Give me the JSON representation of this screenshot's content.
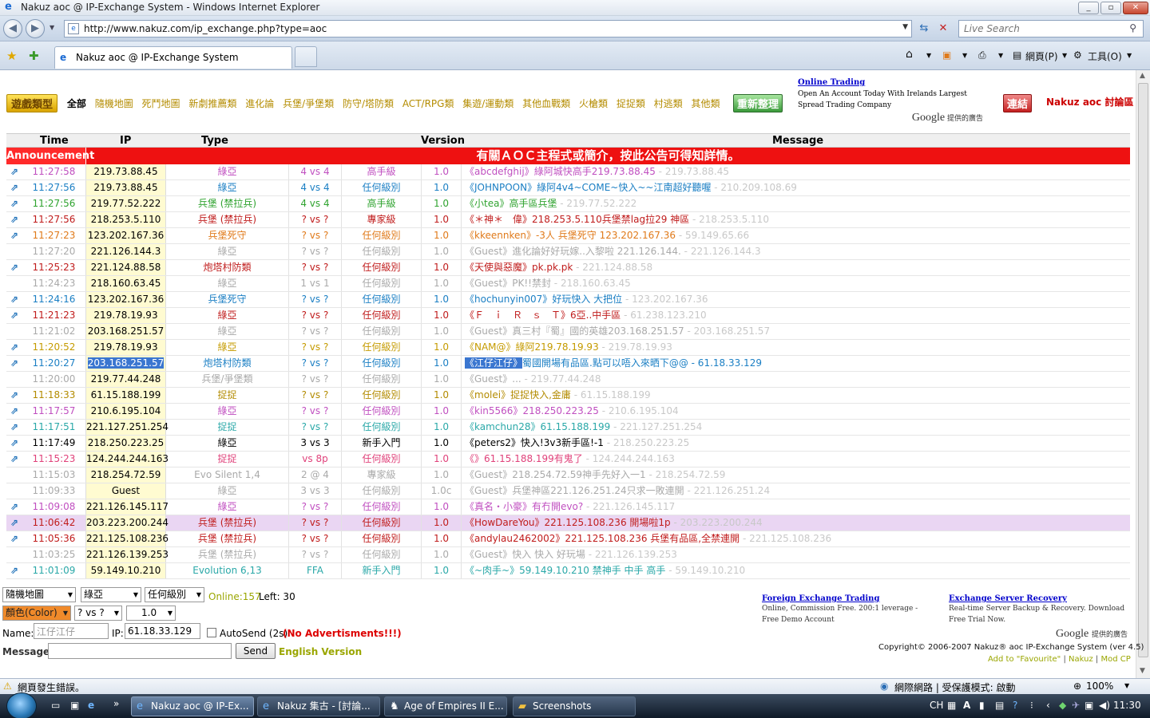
{
  "browser": {
    "title": "Nakuz aoc @ IP-Exchange System - Windows Internet Explorer",
    "url": "http://www.nakuz.com/ip_exchange.php?type=aoc",
    "search_placeholder": "Live Search",
    "tab_label": "Nakuz aoc @ IP-Exchange System",
    "cmd_page": "網頁(P)",
    "cmd_tools": "工具(O)"
  },
  "header": {
    "cat_badge": "遊戲類型",
    "categories": [
      "全部",
      "隨機地圖",
      "死鬥地圖",
      "新劇推薦類",
      "進化論",
      "兵堡/爭堡類",
      "防守/塔防類",
      "ACT/RPG類",
      "集遊/運動類",
      "其他血戰類",
      "火槍類",
      "捉捉類",
      "村逃類",
      "其他類"
    ],
    "refresh_badge": "重新整理",
    "ad_title": "Online Trading",
    "ad_body": "Open An Account Today With Irelands Largest Spread Trading Company",
    "google_ads": "Google",
    "google_ads_sub": "提供的廣告",
    "link_badge": "連結",
    "link_text": "Nakuz aoc 討論區"
  },
  "table": {
    "headers": {
      "time": "Time",
      "ip": "IP",
      "type": "Type",
      "version": "Version",
      "message": "Message"
    },
    "announcement_label": "Announcement",
    "announcement_text": "有關ＡＯＣ主程式或簡介，按此公告可得知詳情。",
    "rows": [
      {
        "icon": true,
        "time": "11:27:58",
        "ip": "219.73.88.45",
        "type": "綠亞",
        "vs": "4 vs 4",
        "level": "高手級",
        "ver": "1.0",
        "sender": "《abcdefghij》",
        "msg": "綠阿城快高手219.73.88.45",
        "mip": " - 219.73.88.45",
        "color": "#c04fc0",
        "sub": "#c04fc0"
      },
      {
        "icon": true,
        "time": "11:27:56",
        "ip": "219.73.88.45",
        "type": "綠亞",
        "vs": "4 vs 4",
        "level": "任何級別",
        "ver": "1.0",
        "sender": "《JOHNPOON》",
        "msg": "綠阿4v4~COME~快入~~江南超好聽喔",
        "mip": " - 210.209.108.69",
        "color": "#1b7fc4",
        "sub": "#1b7fc4"
      },
      {
        "icon": true,
        "time": "11:27:56",
        "ip": "219.77.52.222",
        "type": "兵堡 (禁拉兵)",
        "vs": "4 vs 4",
        "level": "高手級",
        "ver": "1.0",
        "sender": "《小tea》",
        "msg": "高手區兵堡",
        "mip": " - 219.77.52.222",
        "color": "#2fa32f",
        "sub": "#2fa32f"
      },
      {
        "icon": true,
        "time": "11:27:56",
        "ip": "218.253.5.110",
        "type": "兵堡 (禁拉兵)",
        "vs": "? vs ?",
        "level": "專家級",
        "ver": "1.0",
        "sender": "《＊神＊　偉》",
        "msg": "218.253.5.110兵堡禁lag拉29 神區",
        "mip": " - 218.253.5.110",
        "color": "#c01c1c",
        "sub": "#c01c1c"
      },
      {
        "icon": true,
        "time": "11:27:23",
        "ip": "123.202.167.36",
        "type": "兵堡死守",
        "vs": "? vs ?",
        "level": "任何級別",
        "ver": "1.0",
        "sender": "《kkeennken》",
        "msg": "-3人 兵堡死守 123.202.167.36",
        "mip": " - 59.149.65.66",
        "color": "#e07a1a",
        "sub": "#e07a1a"
      },
      {
        "icon": false,
        "time": "11:27:20",
        "ip": "221.126.144.3",
        "type": "綠亞",
        "vs": "? vs ?",
        "level": "任何級別",
        "ver": "1.0",
        "sender": "《Guest》",
        "msg": "進化論好好玩嫁..入黎啦 221.126.144.",
        "mip": " - 221.126.144.3",
        "color": "#aaaaaa",
        "sub": "#aaaaaa"
      },
      {
        "icon": true,
        "time": "11:25:23",
        "ip": "221.124.88.58",
        "type": "炮塔村防類",
        "vs": "? vs ?",
        "level": "任何級別",
        "ver": "1.0",
        "sender": "《天使與惡魔》",
        "msg": "pk.pk.pk",
        "mip": " - 221.124.88.58",
        "color": "#c01c1c",
        "sub": "#c01c1c"
      },
      {
        "icon": false,
        "time": "11:24:23",
        "ip": "218.160.63.45",
        "type": "綠亞",
        "vs": "1 vs 1",
        "level": "任何級別",
        "ver": "1.0",
        "sender": "《Guest》",
        "msg": "PK!!禁封",
        "mip": " - 218.160.63.45",
        "color": "#aaaaaa",
        "sub": "#aaaaaa"
      },
      {
        "icon": true,
        "time": "11:24:16",
        "ip": "123.202.167.36",
        "type": "兵堡死守",
        "vs": "? vs ?",
        "level": "任何級別",
        "ver": "1.0",
        "sender": "《hochunyin007》",
        "msg": "好玩快入 大把位",
        "mip": " - 123.202.167.36",
        "color": "#1b7fc4",
        "sub": "#1b7fc4"
      },
      {
        "icon": true,
        "time": "11:21:23",
        "ip": "219.78.19.93",
        "type": "綠亞",
        "vs": "? vs ?",
        "level": "任何級別",
        "ver": "1.0",
        "sender": "《Ｆ　ｉ　Ｒ　ｓ　Ｔ》",
        "msg": "6亞..中手區",
        "mip": " - 61.238.123.210",
        "color": "#c01c1c",
        "sub": "#c01c1c"
      },
      {
        "icon": false,
        "time": "11:21:02",
        "ip": "203.168.251.57",
        "type": "綠亞",
        "vs": "? vs ?",
        "level": "任何級別",
        "ver": "1.0",
        "sender": "《Guest》",
        "msg": "真三村『蜀』國的英雄203.168.251.57",
        "mip": " - 203.168.251.57",
        "color": "#aaaaaa",
        "sub": "#aaaaaa"
      },
      {
        "icon": true,
        "time": "11:20:52",
        "ip": "219.78.19.93",
        "type": "綠亞",
        "vs": "? vs ?",
        "level": "任何級別",
        "ver": "1.0",
        "sender": "《NAM@》",
        "msg": "綠阿219.78.19.93",
        "mip": " - 219.78.19.93",
        "color": "#c59b00",
        "sub": "#c59b00"
      },
      {
        "icon": true,
        "time": "11:20:27",
        "ip": "203.168.251.57",
        "type": "炮塔村防類",
        "vs": "? vs ?",
        "level": "任何級別",
        "ver": "1.0",
        "sender": "《江仔江仔》",
        "msg": "蜀國開場有品區.點可以唔入來晒下@@",
        "mip": " - 61.18.33.129",
        "color": "#1b7fc4",
        "sub": "#1b7fc4",
        "selected": true
      },
      {
        "icon": false,
        "time": "11:20:00",
        "ip": "219.77.44.248",
        "type": "兵堡/爭堡類",
        "vs": "? vs ?",
        "level": "任何級別",
        "ver": "1.0",
        "sender": "《Guest》",
        "msg": "...",
        "mip": " - 219.77.44.248",
        "color": "#aaaaaa",
        "sub": "#aaaaaa"
      },
      {
        "icon": true,
        "time": "11:18:33",
        "ip": "61.15.188.199",
        "type": "捉捉",
        "vs": "? vs ?",
        "level": "任何級別",
        "ver": "1.0",
        "sender": "《molei》",
        "msg": "捉捉快入,金庸",
        "mip": " - 61.15.188.199",
        "color": "#b38b00",
        "sub": "#b38b00"
      },
      {
        "icon": true,
        "time": "11:17:57",
        "ip": "210.6.195.104",
        "type": "綠亞",
        "vs": "? vs ?",
        "level": "任何級別",
        "ver": "1.0",
        "sender": "《kin5566》",
        "msg": "218.250.223.25",
        "mip": " - 210.6.195.104",
        "color": "#c04fc0",
        "sub": "#c04fc0"
      },
      {
        "icon": true,
        "time": "11:17:51",
        "ip": "221.127.251.254",
        "type": "捉捉",
        "vs": "? vs ?",
        "level": "任何級別",
        "ver": "1.0",
        "sender": "《kamchun28》",
        "msg": "61.15.188.199",
        "mip": " - 221.127.251.254",
        "color": "#2aa8a8",
        "sub": "#2aa8a8"
      },
      {
        "icon": true,
        "time": "11:17:49",
        "ip": "218.250.223.25",
        "type": "綠亞",
        "vs": "3 vs 3",
        "level": "新手入門",
        "ver": "1.0",
        "sender": "《peters2》",
        "msg": "快入!3v3新手區!-1",
        "mip": " - 218.250.223.25",
        "color": "#000000",
        "sub": "#000000"
      },
      {
        "icon": true,
        "time": "11:15:23",
        "ip": "124.244.244.163",
        "type": "捉捉",
        "vs": "vs 8p",
        "level": "任何級別",
        "ver": "1.0",
        "sender": "《》",
        "msg": "61.15.188.199有鬼了",
        "mip": " - 124.244.244.163",
        "color": "#e0417a",
        "sub": "#e0417a"
      },
      {
        "icon": false,
        "time": "11:15:03",
        "ip": "218.254.72.59",
        "type": "Evo Silent 1,4",
        "vs": "2 @ 4",
        "level": "專家級",
        "ver": "1.0",
        "sender": "《Guest》",
        "msg": "218.254.72.59神手先好入一1",
        "mip": " - 218.254.72.59",
        "color": "#aaaaaa",
        "sub": "#aaaaaa"
      },
      {
        "icon": false,
        "time": "11:09:33",
        "ip": "Guest",
        "type": "綠亞",
        "vs": "3 vs 3",
        "level": "任何級別",
        "ver": "1.0c",
        "sender": "《Guest》",
        "msg": "兵堡神區221.126.251.24只求一敗連開",
        "mip": " - 221.126.251.24",
        "color": "#aaaaaa",
        "sub": "#aaaaaa"
      },
      {
        "icon": true,
        "time": "11:09:08",
        "ip": "221.126.145.117",
        "type": "綠亞",
        "vs": "? vs ?",
        "level": "任何級別",
        "ver": "1.0",
        "sender": "《真名・小豪》",
        "msg": "有冇開evo?",
        "mip": " - 221.126.145.117",
        "color": "#c04fc0",
        "sub": "#c04fc0"
      },
      {
        "icon": true,
        "time": "11:06:42",
        "ip": "203.223.200.244",
        "type": "兵堡 (禁拉兵)",
        "vs": "? vs ?",
        "level": "任何級別",
        "ver": "1.0",
        "sender": "《HowDareYou》",
        "msg": "221.125.108.236 開場啦1p",
        "mip": " - 203.223.200.244",
        "color": "#c01c1c",
        "sub": "#c01c1c",
        "highlight": true
      },
      {
        "icon": true,
        "time": "11:05:36",
        "ip": "221.125.108.236",
        "type": "兵堡 (禁拉兵)",
        "vs": "? vs ?",
        "level": "任何級別",
        "ver": "1.0",
        "sender": "《andylau2462002》",
        "msg": "221.125.108.236 兵堡有品區,全禁連開",
        "mip": " - 221.125.108.236",
        "color": "#c01c1c",
        "sub": "#c01c1c"
      },
      {
        "icon": false,
        "time": "11:03:25",
        "ip": "221.126.139.253",
        "type": "兵堡 (禁拉兵)",
        "vs": "? vs ?",
        "level": "任何級別",
        "ver": "1.0",
        "sender": "《Guest》",
        "msg": "快入 快入 好玩場",
        "mip": " - 221.126.139.253",
        "color": "#aaaaaa",
        "sub": "#aaaaaa"
      },
      {
        "icon": true,
        "time": "11:01:09",
        "ip": "59.149.10.210",
        "type": "Evolution 6,13",
        "vs": "FFA",
        "level": "新手入門",
        "ver": "1.0",
        "sender": "《~肉手~》",
        "msg": "59.149.10.210 禁神手 中手 高手",
        "mip": " - 59.149.10.210",
        "color": "#2aa8a8",
        "sub": "#2aa8a8"
      }
    ]
  },
  "form": {
    "map_select": "隨機地圖",
    "type_select": "綠亞",
    "level_select": "任何級別",
    "online": "Online:157",
    "left": "Left: 30",
    "color_select": "顏色(Color)",
    "vs_select": "? vs ?",
    "ver_select": "1.0",
    "name_label": "Name:",
    "name_value": "江仔江仔",
    "ip_label": "IP:",
    "ip_value": "61.18.33.129",
    "autosend_label": "AutoSend (2s)",
    "no_ads": "(No Advertisments!!!)",
    "message_label": "Message:",
    "message_value": "",
    "send_label": "Send",
    "english_version": "English Version"
  },
  "footer_ads": {
    "ad1_title": "Foreign Exchange Trading",
    "ad1_body": "Online, Commission Free. 200:1 leverage - Free Demo Account",
    "ad2_title": "Exchange Server Recovery",
    "ad2_body": "Real-time Server Backup & Recovery. Download Free Trial Now.",
    "google_ads": "Google",
    "google_ads_sub": "提供的廣告",
    "copyright": "Copyright© 2006-2007  Nakuz® aoc IP-Exchange System (ver 4.5)",
    "favourite": "Add to \"Favourite\"",
    "nakuz_link": "Nakuz",
    "modcp_link": "Mod CP"
  },
  "statusbar": {
    "error_text": "網頁發生錯誤。",
    "zone_text": "網際網路 | 受保護模式: 啟動",
    "zoom": "100%"
  },
  "taskbar": {
    "items": [
      "Nakuz aoc @ IP-Ex...",
      "Nakuz 集古 - [討論...",
      "Age of Empires II E...",
      "Screenshots"
    ],
    "lang": "CH",
    "clock": "11:30"
  },
  "colors": {
    "announcement": "#ee1111",
    "ip_cell": "#fffbd1",
    "highlight_row": "#ead6f3",
    "selection": "#3a76d0"
  }
}
